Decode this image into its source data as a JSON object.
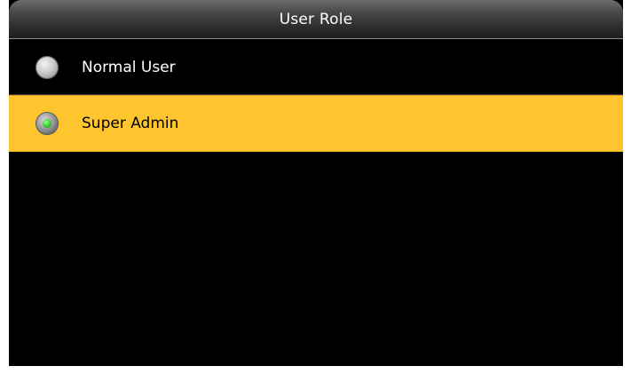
{
  "header": {
    "title": "User Role"
  },
  "options": [
    {
      "label": "Normal User",
      "selected": false,
      "icon": "radio-unchecked-icon"
    },
    {
      "label": "Super Admin",
      "selected": true,
      "icon": "radio-checked-icon"
    }
  ],
  "colors": {
    "background": "#000000",
    "highlight": "#fec52e",
    "radio_checked": "#2fcb2a",
    "title_bar": "#3a3a3a"
  }
}
